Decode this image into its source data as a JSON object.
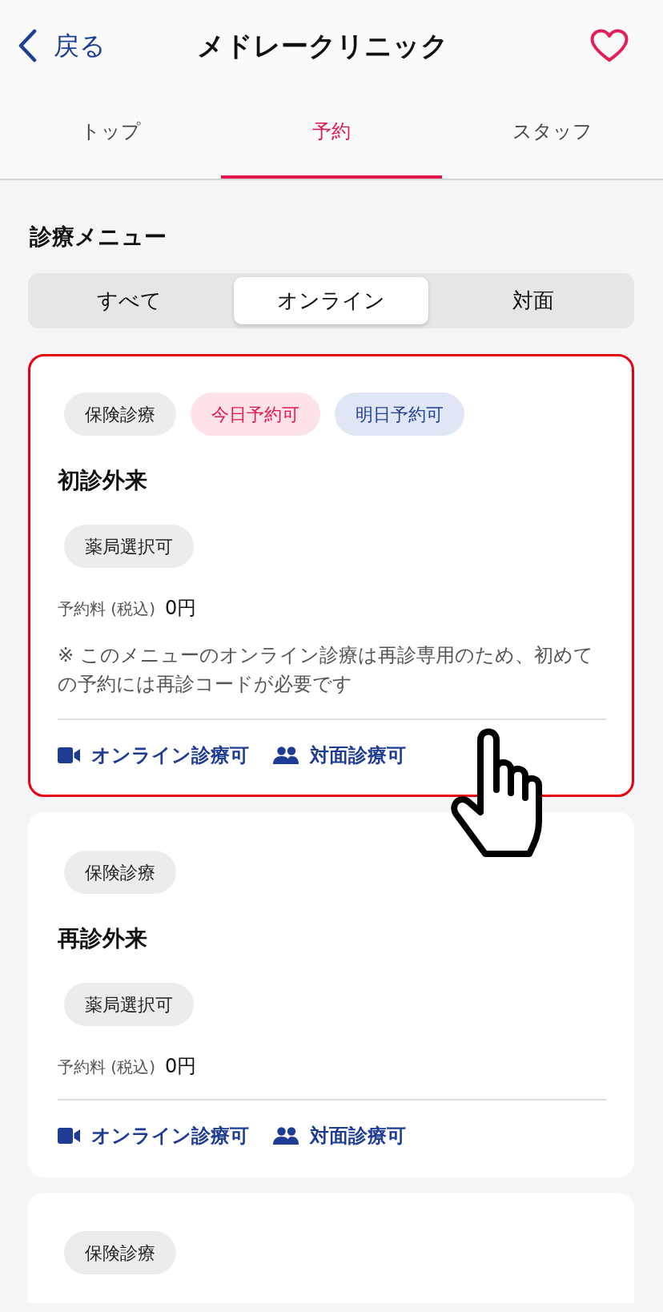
{
  "header": {
    "back_label": "戻る",
    "title": "メドレークリニック",
    "favorited": false
  },
  "tabs": [
    {
      "label": "トップ",
      "selected": false
    },
    {
      "label": "予約",
      "selected": true
    },
    {
      "label": "スタッフ",
      "selected": false
    }
  ],
  "section_title": "診療メニュー",
  "segments": [
    {
      "label": "すべて",
      "selected": false
    },
    {
      "label": "オンライン",
      "selected": true
    },
    {
      "label": "対面",
      "selected": false
    }
  ],
  "menu_cards": [
    {
      "selected": true,
      "tags": [
        {
          "label": "保険診療",
          "kind": "insurance"
        },
        {
          "label": "今日予約可",
          "kind": "today"
        },
        {
          "label": "明日予約可",
          "kind": "tomorrow"
        }
      ],
      "title": "初診外来",
      "features": [
        "薬局選択可"
      ],
      "fee_label": "予約料 (税込)",
      "fee_value": "0円",
      "note": "※ このメニューのオンライン診療は再診専用のため、初めての予約には再診コードが必要です",
      "availability": [
        {
          "kind": "online",
          "label": "オンライン診療可"
        },
        {
          "kind": "facetoface",
          "label": "対面診療可"
        }
      ]
    },
    {
      "selected": false,
      "tags": [
        {
          "label": "保険診療",
          "kind": "insurance"
        }
      ],
      "title": "再診外来",
      "features": [
        "薬局選択可"
      ],
      "fee_label": "予約料 (税込)",
      "fee_value": "0円",
      "availability": [
        {
          "kind": "online",
          "label": "オンライン診療可"
        },
        {
          "kind": "facetoface",
          "label": "対面診療可"
        }
      ]
    },
    {
      "selected": false,
      "tags": [
        {
          "label": "保険診療",
          "kind": "insurance"
        }
      ]
    }
  ]
}
